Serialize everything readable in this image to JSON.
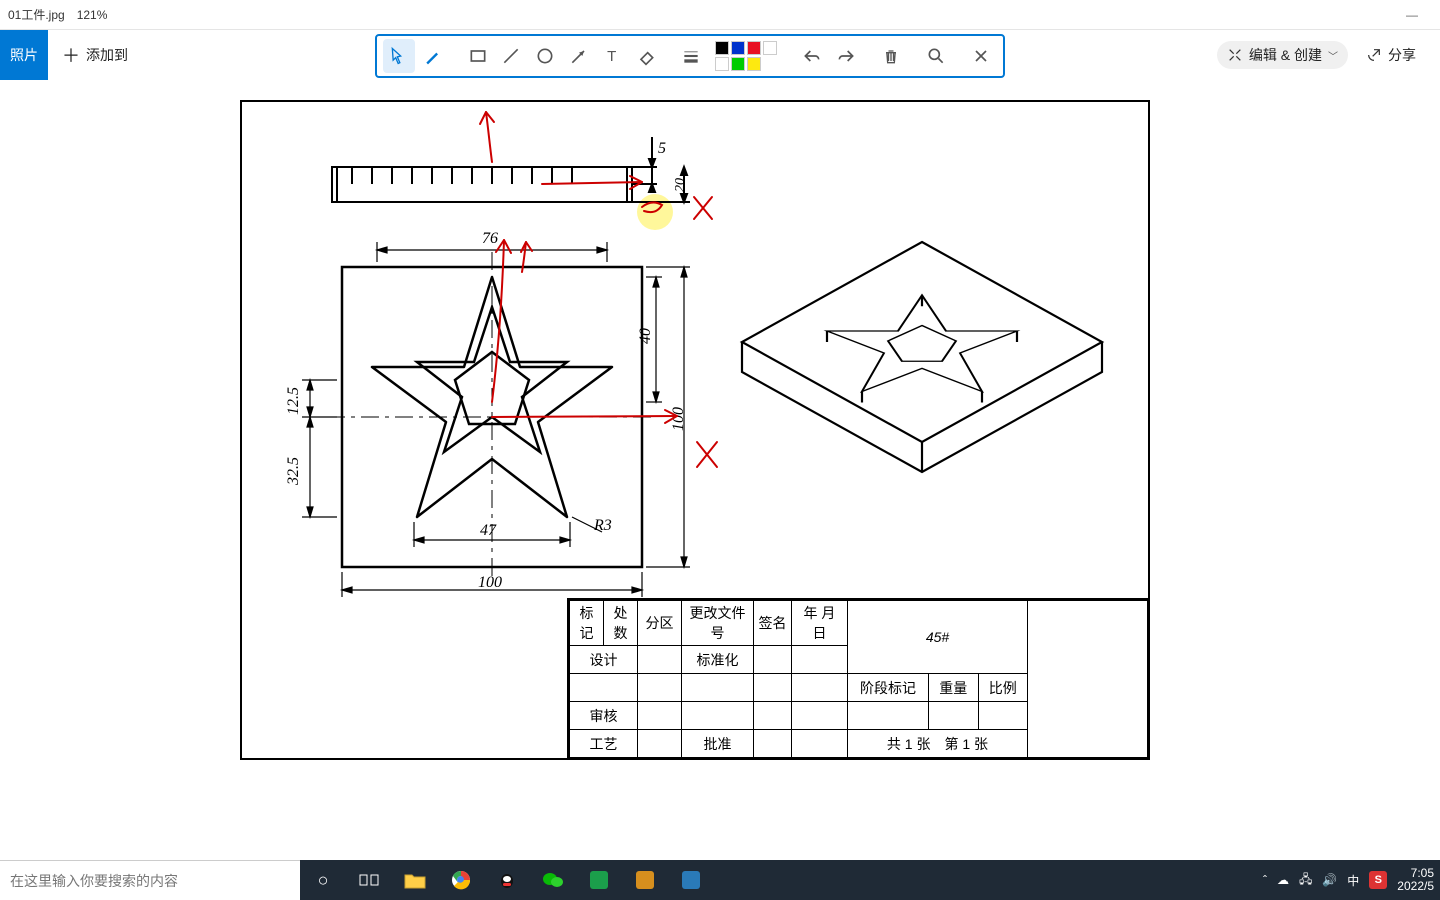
{
  "titlebar": {
    "filename": "01工件.jpg",
    "zoom": "121%"
  },
  "approw": {
    "photosTab": "照片",
    "addTo": "添加到",
    "editCreate": "编辑 & 创建",
    "share": "分享"
  },
  "toolbar": {
    "swatches": [
      "#000000",
      "#0033cc",
      "#e81123",
      "#ffffff",
      "#00cc00",
      "#fde910"
    ]
  },
  "drawing": {
    "dims": {
      "d100": "100",
      "d76": "76",
      "d47": "47",
      "d40": "40",
      "d125": "12.5",
      "d325": "32.5",
      "r3": "R3",
      "d5": "5",
      "d20": "20"
    },
    "titleblock": {
      "hdr": [
        "标记",
        "处数",
        "分区",
        "更改文件号",
        "签名",
        "年 月 日"
      ],
      "design": "设计",
      "std": "标准化",
      "review": "审核",
      "process": "工艺",
      "approve": "批准",
      "material": "45#",
      "stage": "阶段标记",
      "weight": "重量",
      "scale": "比例",
      "sheets": "共 1 张　第 1 张",
      "d100r": "100"
    }
  },
  "taskbar": {
    "searchPlaceholder": "在这里输入你要搜索的内容",
    "trayIME": "中",
    "clockTime": "7:05",
    "clockDate": "2022/5"
  }
}
